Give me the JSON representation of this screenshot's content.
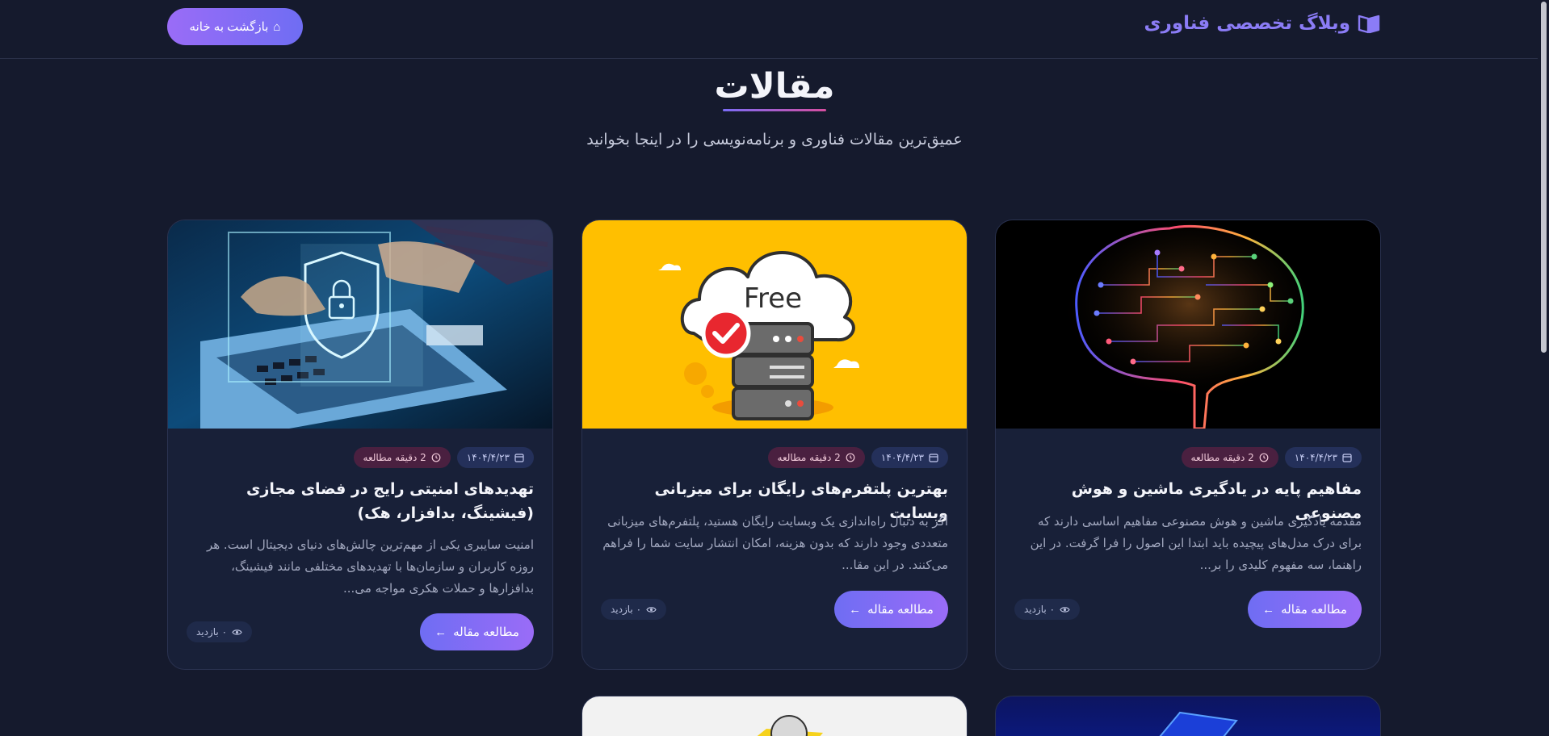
{
  "header": {
    "brand_title": "وبلاگ تخصصی فناوری",
    "home_button_label": "بازگشت به خانه"
  },
  "hero": {
    "title": "مقالات",
    "subtitle": "عمیق‌ترین مقالات فناوری و برنامه‌نویسی را در اینجا بخوانید"
  },
  "cards": [
    {
      "title": "مفاهیم پایه در یادگیری ماشین و هوش مصنوعی",
      "date": "۱۴۰۴/۴/۲۳",
      "read_time": "2 دقیقه مطالعه",
      "excerpt": "مقدمه یادگیری ماشین و هوش مصنوعی مفاهیم اساسی دارند که برای درک مدل‌های پیچیده باید ابتدا این اصول را فرا گرفت. در این راهنما، سه مفهوم کلیدی را بر...",
      "read_button": "مطالعه مقاله",
      "views": "۰ بازدید"
    },
    {
      "title": "بهترین پلتفرم‌های رایگان برای میزبانی وبسایت",
      "date": "۱۴۰۴/۴/۲۳",
      "read_time": "2 دقیقه مطالعه",
      "excerpt": "اگر به دنبال راه‌اندازی یک وبسایت رایگان هستید، پلتفرم‌های میزبانی متعددی وجود دارند که بدون هزینه، امکان انتشار سایت شما را فراهم می‌کنند. در این مقا...",
      "read_button": "مطالعه مقاله",
      "views": "۰ بازدید",
      "image_text": "Free"
    },
    {
      "title": "تهدیدهای امنیتی رایج در فضای مجازی (فیشینگ، بدافزار، هک)",
      "date": "۱۴۰۴/۴/۲۳",
      "read_time": "2 دقیقه مطالعه",
      "excerpt": "امنیت سایبری یکی از مهم‌ترین چالش‌های دنیای دیجیتال است. هر روزه کاربران و سازمان‌ها با تهدیدهای مختلفی مانند فیشینگ، بدافزارها و حملات هکری مواجه می...",
      "read_button": "مطالعه مقاله",
      "views": "۰ بازدید"
    }
  ],
  "colors": {
    "background": "#151a2d",
    "card": "#182038",
    "accent": "#7b6cf6",
    "accent_pink": "#d64ea0"
  }
}
